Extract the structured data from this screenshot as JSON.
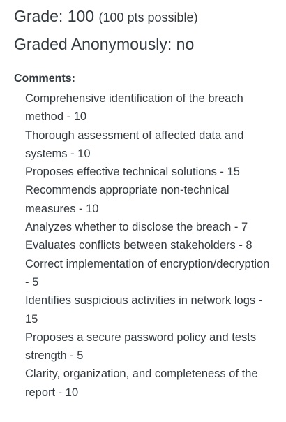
{
  "grade": {
    "label": "Grade: 100",
    "possible": "(100 pts possible)"
  },
  "anonymous": {
    "label": "Graded Anonymously: no"
  },
  "comments": {
    "heading": "Comments:",
    "items": [
      "Comprehensive identification of the breach method - 10",
      "Thorough assessment of affected data and systems - 10",
      "Proposes effective technical solutions - 15",
      "Recommends appropriate non-technical measures - 10",
      "Analyzes whether to disclose the breach - 7",
      "Evaluates conflicts between stakeholders - 8",
      "Correct implementation of encryption/decryption - 5",
      "Identifies suspicious activities in network logs - 15",
      "Proposes a secure password policy and tests strength - 5",
      "Clarity, organization, and completeness of the report - 10"
    ]
  }
}
